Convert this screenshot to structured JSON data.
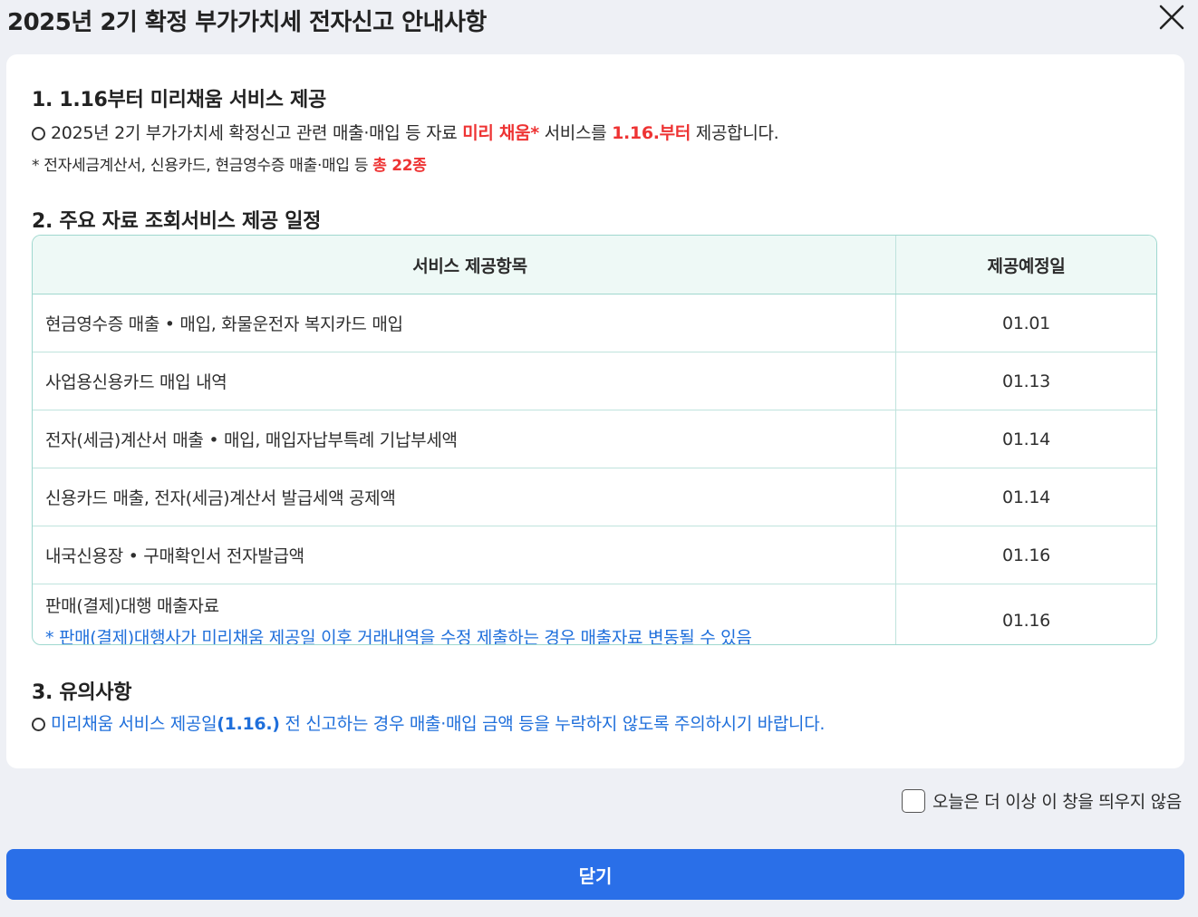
{
  "dialog": {
    "title": "2025년 2기 확정 부가가치세 전자신고 안내사항"
  },
  "section1": {
    "title": "1. 1.16부터 미리채움 서비스 제공",
    "line1_prefix": "2025년 2기 부가가치세 확정신고 관련 매출·매입 등 자료 ",
    "line1_highlight1": "미리 채움*",
    "line1_middle": " 서비스를 ",
    "line1_highlight2": "1.16.부터",
    "line1_suffix": " 제공합니다.",
    "note_prefix": "* 전자세금계산서, 신용카드, 현금영수증 매출·매입 등 ",
    "note_highlight": "총 22종"
  },
  "section2": {
    "title": "2. 주요 자료 조회서비스 제공 일정",
    "headers": [
      "서비스 제공항목",
      "제공예정일"
    ],
    "rows": [
      {
        "item": "현금영수증 매출 • 매입, 화물운전자 복지카드 매입",
        "date": "01.01"
      },
      {
        "item": "사업용신용카드 매입 내역",
        "date": "01.13"
      },
      {
        "item": "전자(세금)계산서 매출 • 매입, 매입자납부특례 기납부세액",
        "date": "01.14"
      },
      {
        "item": "신용카드 매출, 전자(세금)계산서 발급세액 공제액",
        "date": "01.14"
      },
      {
        "item": "내국신용장 • 구매확인서 전자발급액",
        "date": "01.16"
      },
      {
        "item": "판매(결제)대행 매출자료",
        "date": "01.16",
        "note": "* 판매(결제)대행사가 미리채움 제공일 이후 거래내역을 수정 제출하는 경우 매출자료 변동될 수 있음"
      }
    ]
  },
  "section3": {
    "title": "3. 유의사항",
    "line_prefix": "미리채움 서비스 제공일",
    "line_bold": "(1.16.)",
    "line_suffix": " 전 신고하는 경우 매출·매입 금액 등을 누락하지 않도록 주의하시기 바랍니다."
  },
  "footer": {
    "dont_show_label": "오늘은 더 이상 이 창을 띄우지 않음",
    "close_label": "닫기"
  },
  "colors": {
    "accent_red": "#ee3333",
    "accent_blue": "#1f6fdb",
    "button_blue": "#2a6fe8",
    "table_border": "#9fd8cf"
  }
}
